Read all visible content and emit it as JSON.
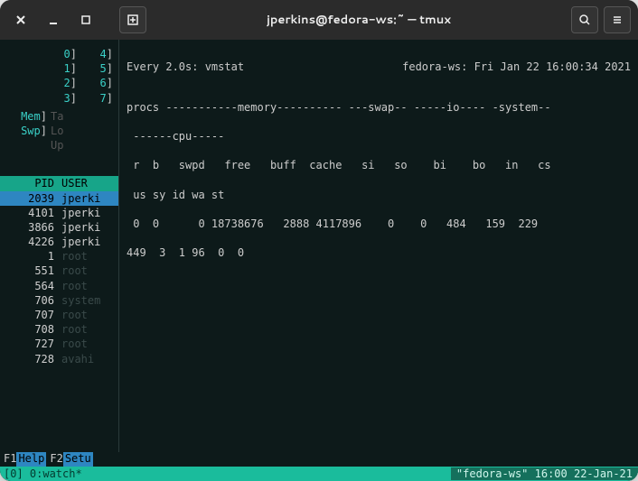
{
  "window": {
    "title": "jperkins@fedora-ws:~ — tmux"
  },
  "htop": {
    "cpus": [
      {
        "a": "0",
        "b": "4"
      },
      {
        "a": "1",
        "b": "5"
      },
      {
        "a": "2",
        "b": "6"
      },
      {
        "a": "3",
        "b": "7"
      }
    ],
    "rows": [
      {
        "l": "Mem",
        "r": "Ta"
      },
      {
        "l": "Swp",
        "r": "Lo"
      },
      {
        "l": "",
        "r": "Up"
      }
    ],
    "header": {
      "pid": "PID",
      "user": "USER"
    },
    "procs": [
      {
        "pid": "2039",
        "user": "jperki",
        "sel": true,
        "dim": false
      },
      {
        "pid": "4101",
        "user": "jperki",
        "sel": false,
        "dim": false
      },
      {
        "pid": "3866",
        "user": "jperki",
        "sel": false,
        "dim": false
      },
      {
        "pid": "4226",
        "user": "jperki",
        "sel": false,
        "dim": false
      },
      {
        "pid": "1",
        "user": "root",
        "sel": false,
        "dim": true
      },
      {
        "pid": "551",
        "user": "root",
        "sel": false,
        "dim": true
      },
      {
        "pid": "564",
        "user": "root",
        "sel": false,
        "dim": true
      },
      {
        "pid": "706",
        "user": "system",
        "sel": false,
        "dim": true
      },
      {
        "pid": "707",
        "user": "root",
        "sel": false,
        "dim": true
      },
      {
        "pid": "708",
        "user": "root",
        "sel": false,
        "dim": true
      },
      {
        "pid": "727",
        "user": "root",
        "sel": false,
        "dim": true
      },
      {
        "pid": "728",
        "user": "avahi",
        "sel": false,
        "dim": true
      }
    ],
    "fn": [
      {
        "key": "F1",
        "label": "Help"
      },
      {
        "key": "F2",
        "label": "Setu"
      }
    ]
  },
  "vmstat": {
    "cmd": "Every 2.0s: vmstat",
    "host": "fedora-ws: Fri Jan 22 16:00:34 2021",
    "line1": "procs -----------memory---------- ---swap-- -----io---- -system--",
    "line2": " ------cpu-----",
    "line3": " r  b   swpd   free   buff  cache   si   so    bi    bo   in   cs",
    "line4": " us sy id wa st",
    "line5": " 0  0      0 18738676   2888 4117896    0    0   484   159  229 ",
    "line6": "449  3  1 96  0  0"
  },
  "tmux": {
    "left": "[0] 0:watch*",
    "right": "\"fedora-ws\" 16:00 22-Jan-21"
  },
  "chart_data": {
    "type": "table",
    "title": "vmstat",
    "columns": [
      "r",
      "b",
      "swpd",
      "free",
      "buff",
      "cache",
      "si",
      "so",
      "bi",
      "bo",
      "in",
      "cs",
      "us",
      "sy",
      "id",
      "wa",
      "st"
    ],
    "rows": [
      [
        0,
        0,
        0,
        18738676,
        2888,
        4117896,
        0,
        0,
        484,
        159,
        229,
        449,
        3,
        1,
        96,
        0,
        0
      ]
    ]
  }
}
